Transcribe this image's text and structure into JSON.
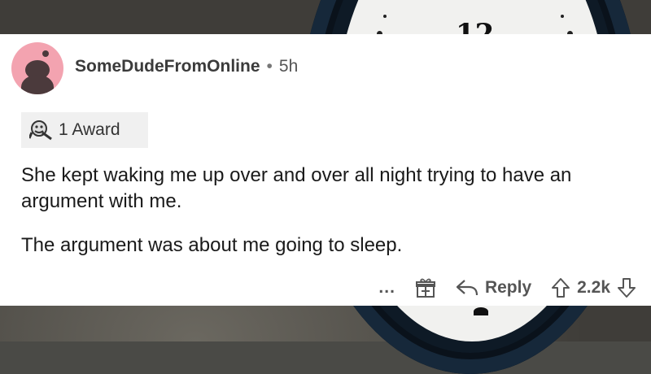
{
  "comment": {
    "username": "SomeDudeFromOnline",
    "separator": "•",
    "time": "5h",
    "award_label": "1 Award",
    "paragraphs": [
      "She kept waking me up over and over all night trying to have an argument with me.",
      "The argument was about me going to sleep."
    ]
  },
  "actions": {
    "more_label": "...",
    "reply_label": "Reply",
    "score": "2.2k"
  },
  "icons": {
    "avatar": "reddit-avatar-icon",
    "award": "wholesome-award-icon",
    "gift": "gift-icon",
    "reply": "reply-arrow-icon",
    "upvote": "upvote-arrow-icon",
    "downvote": "downvote-arrow-icon"
  },
  "colors": {
    "card_bg": "#ffffff",
    "avatar_bg": "#f3a3b0",
    "award_bg": "#f0f0f0",
    "text": "#1a1a1a",
    "meta": "#555555"
  },
  "background": {
    "clock_numeral_top": "12"
  }
}
